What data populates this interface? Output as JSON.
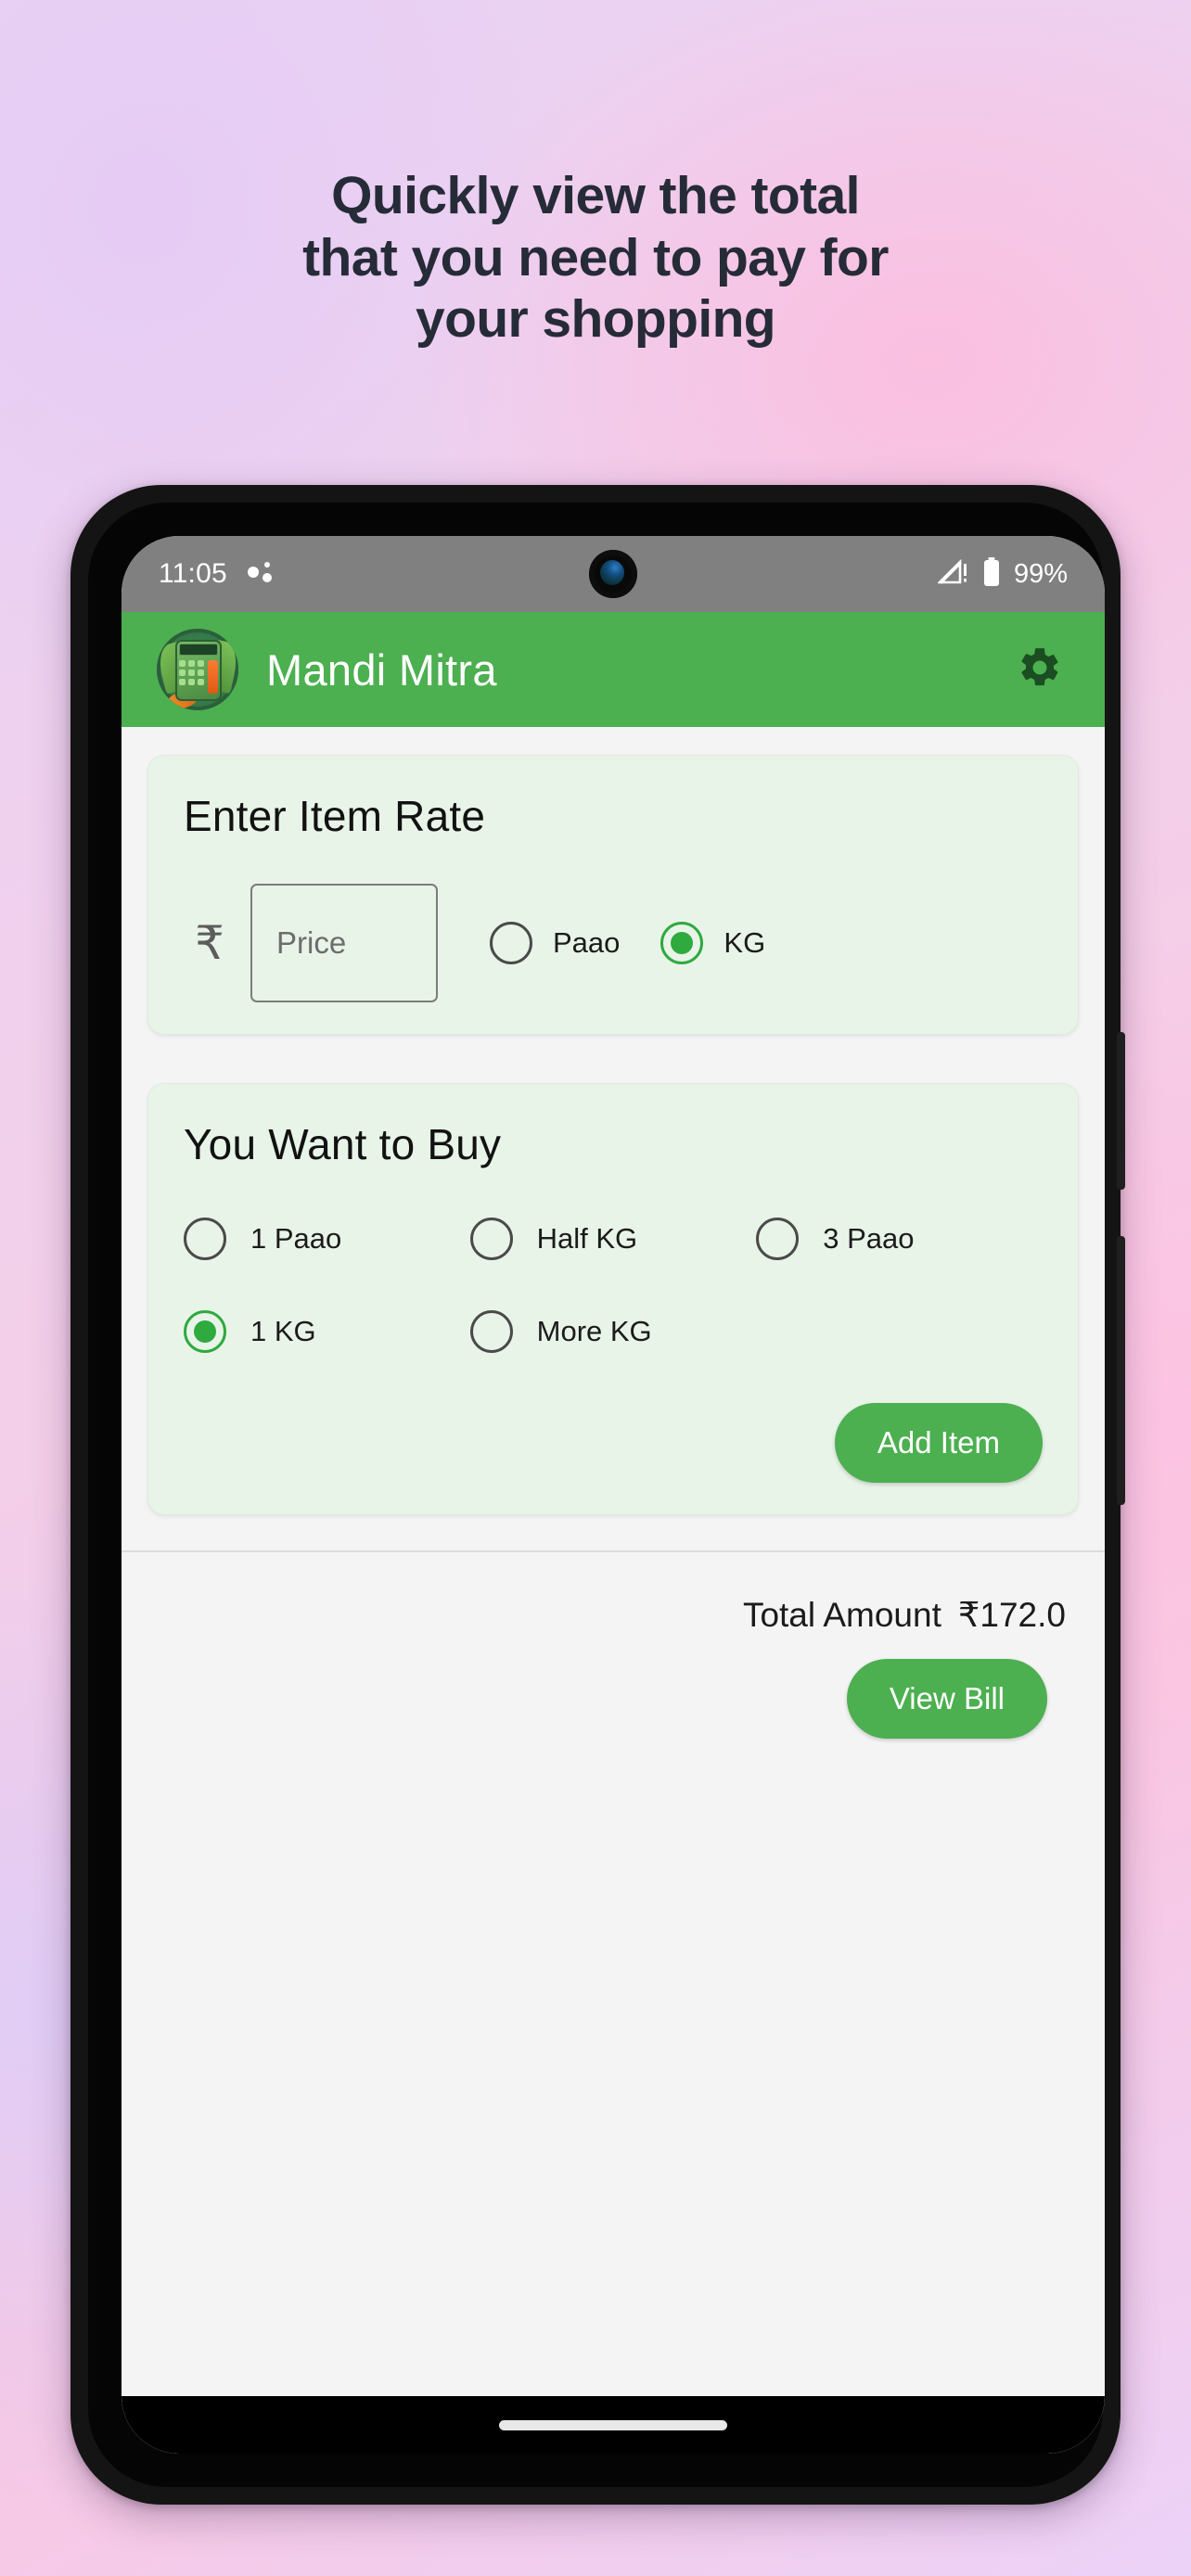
{
  "promo": {
    "headline_lines": [
      "Quickly view the total",
      "that you need to pay for",
      "your shopping"
    ]
  },
  "status_bar": {
    "time": "11:05",
    "battery_percent": "99%",
    "signal_icon": "signal-no-sim-icon",
    "battery_icon": "battery-icon",
    "notification_icon": "notification-dots-icon"
  },
  "app_bar": {
    "title": "Mandi Mitra",
    "logo_icon": "app-logo-calculator-vegetables-icon",
    "settings_icon": "gear-icon",
    "background_color": "#4caf50"
  },
  "rate_card": {
    "title": "Enter Item Rate",
    "currency_symbol": "₹",
    "price_placeholder": "Price",
    "price_value": "",
    "unit_options": [
      {
        "label": "Paao",
        "selected": false
      },
      {
        "label": "KG",
        "selected": true
      }
    ]
  },
  "buy_card": {
    "title": "You Want to Buy",
    "quantity_options": [
      {
        "label": "1 Paao",
        "selected": false
      },
      {
        "label": "Half KG",
        "selected": false
      },
      {
        "label": "3 Paao",
        "selected": false
      },
      {
        "label": "1 KG",
        "selected": true
      },
      {
        "label": "More KG",
        "selected": false
      }
    ],
    "add_item_label": "Add Item"
  },
  "footer": {
    "total_label": "Total Amount",
    "total_value": "₹172.0",
    "view_bill_label": "View Bill"
  },
  "theme": {
    "accent_green": "#4caf50",
    "radio_green": "#2eaa3f",
    "card_bg": "#e9f4e9",
    "screen_bg": "#f4f4f4",
    "headline_color": "#262b38"
  }
}
